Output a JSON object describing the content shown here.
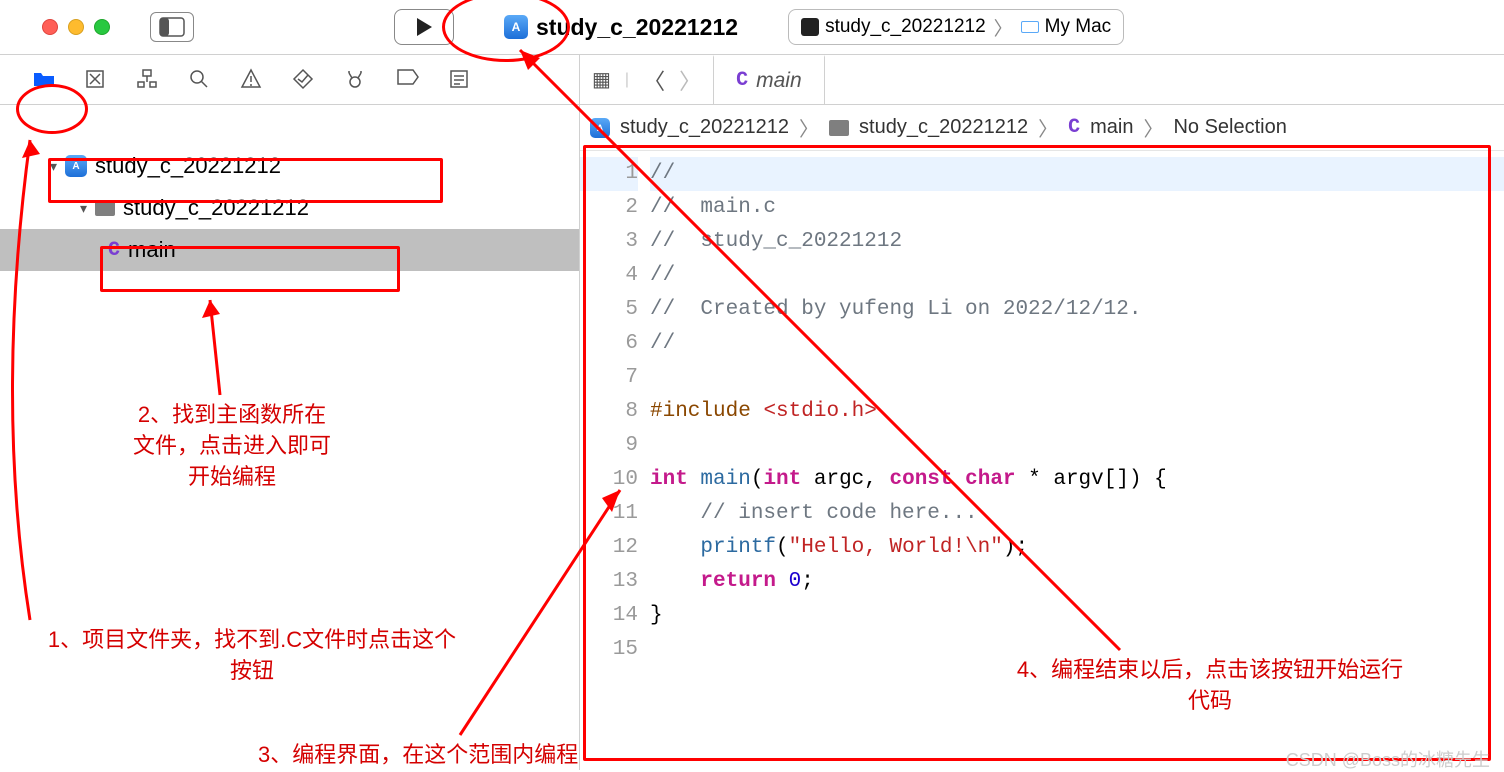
{
  "titlebar": {
    "project_title": "study_c_20221212",
    "destination_scheme": "study_c_20221212",
    "destination_device": "My Mac"
  },
  "tab": {
    "c_label": "C",
    "filename": "main"
  },
  "sidebar": {
    "root": "study_c_20221212",
    "folder": "study_c_20221212",
    "file_c": "C",
    "file_name": "main"
  },
  "crumb": {
    "seg1": "study_c_20221212",
    "seg2": "study_c_20221212",
    "seg3_c": "C",
    "seg3": "main",
    "seg4": "No Selection"
  },
  "code": {
    "lines": [
      "//",
      "//  main.c",
      "//  study_c_20221212",
      "//",
      "//  Created by yufeng Li on 2022/12/12.",
      "//",
      "",
      "#include <stdio.h>",
      "",
      "int main(int argc, const char * argv[]) {",
      "    // insert code here...",
      "    printf(\"Hello, World!\\n\");",
      "    return 0;",
      "}",
      ""
    ]
  },
  "annotations": {
    "a1": "1、项目文件夹，找不到.C文件时点击这个按钮",
    "a2": "2、找到主函数所在文件，点击进入即可开始编程",
    "a3": "3、编程界面，在这个范围内编程",
    "a4": "4、编程结束以后，点击该按钮开始运行代码"
  },
  "watermark": "CSDN @Boss的冰糖先生"
}
